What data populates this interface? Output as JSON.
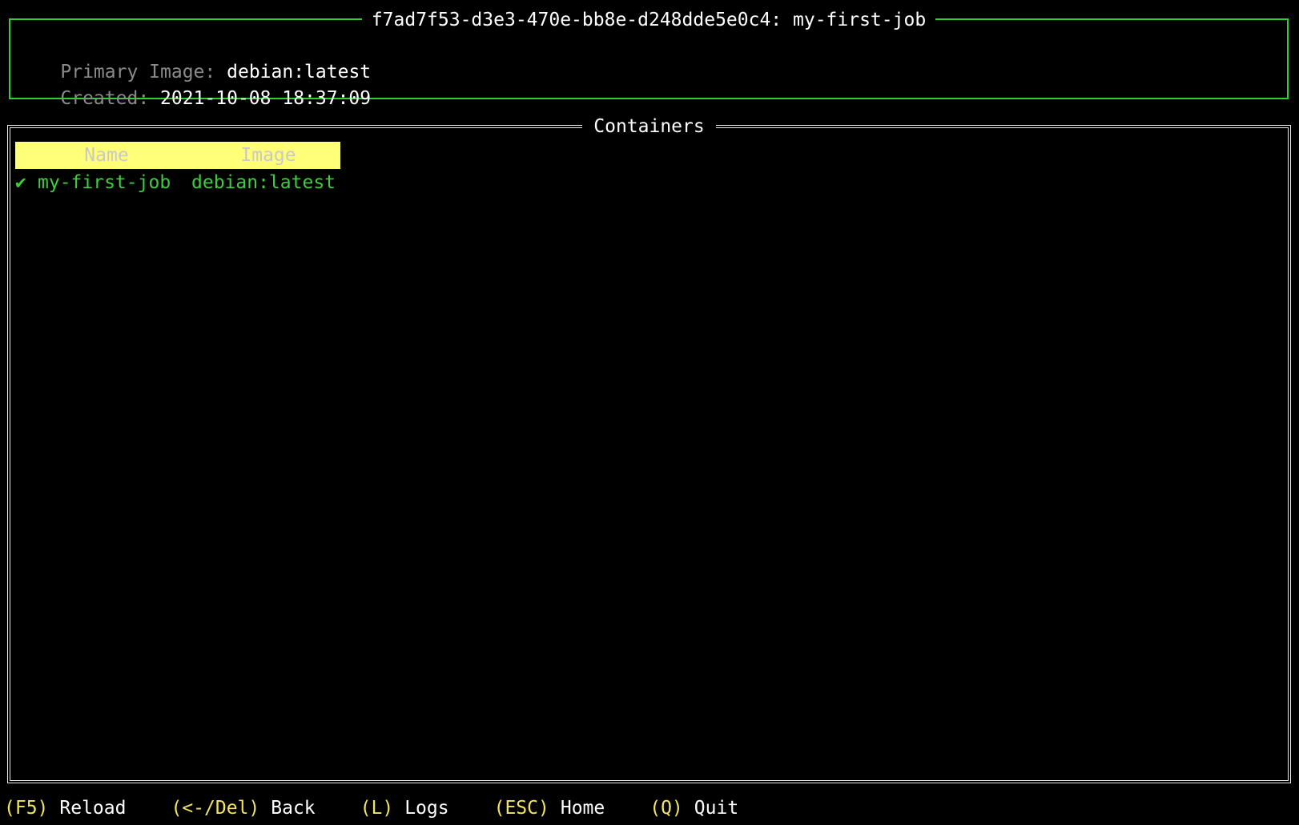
{
  "job": {
    "title": "f7ad7f53-d3e3-470e-bb8e-d248dde5e0c4: my-first-job",
    "primary_image_label": "Primary Image:",
    "primary_image_value": "debian:latest",
    "created_label": "Created:",
    "created_value": "2021-10-08 18:37:09"
  },
  "containers": {
    "title": "Containers",
    "columns": [
      "Name",
      "Image"
    ],
    "rows": [
      {
        "status_icon": "check-icon",
        "status_glyph": "✔",
        "name": "my-first-job",
        "image": "debian:latest"
      }
    ]
  },
  "footer": {
    "keybinds": [
      {
        "key": "(F5)",
        "action": "Reload"
      },
      {
        "key": "(<-/Del)",
        "action": "Back"
      },
      {
        "key": "(L)",
        "action": "Logs"
      },
      {
        "key": "(ESC)",
        "action": "Home"
      },
      {
        "key": "(Q)",
        "action": "Quit"
      }
    ]
  },
  "colors": {
    "panel_border": "#2ed12e",
    "header_bg": "#ffff78",
    "row_text": "#3ccf3c",
    "key_text": "#f3e55f",
    "label_text": "#8a8a8a"
  }
}
